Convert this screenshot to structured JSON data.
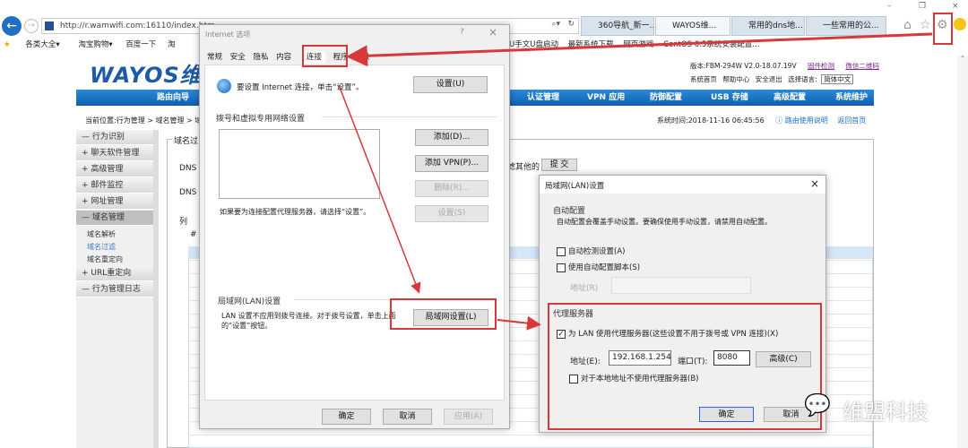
{
  "browser": {
    "url": "http://r.wamwifi.com:16110/index.htm",
    "tabs": [
      "360导航_新一...",
      "WAYOS维...",
      "常用的dns地...",
      "一些常用的公..."
    ],
    "bookmarks": [
      "各类大全▾",
      "淘宝购物▾",
      "百度一下",
      "淘",
      "U手文U盘启动",
      "最新系统下载",
      "网页游戏",
      "CentOS 6.5系统安装配置..."
    ]
  },
  "page": {
    "logo": "WAYOS维",
    "version": "版本:FBM-294W V2.0-18.07.19V",
    "version_links": [
      "固件检测",
      "微信二维码"
    ],
    "top_links": [
      "系统首页",
      "帮助中心",
      "安全退出",
      "选择语言:"
    ],
    "language": "简体中文",
    "nav": [
      "路由向导",
      "认证管理",
      "VPN 应用",
      "防御配置",
      "USB 存储",
      "高级配置",
      "系统维护"
    ],
    "breadcrumb": "当前位置:行为管理 > 域名管理 > 域",
    "system_time": "系统时间:2018-11-16 06:45:56",
    "help_link": "路由使用说明",
    "home_link": "返回首页",
    "sidebar": [
      "行为识别",
      "聊天软件管理",
      "高级管理",
      "邮件监控",
      "网址管理",
      "域名管理",
      "URL重定向",
      "行为管理日志"
    ],
    "sidebar_sub": [
      "域名解析",
      "域名过滤",
      "域名重定向"
    ],
    "content": {
      "legend": "域名过",
      "dns1": "DNS 过",
      "dns2": "DNS 1",
      "list": "列",
      "hash": "#",
      "filter_other": "滤其他的",
      "submit": "提 交"
    }
  },
  "inet_dialog": {
    "title": "Internet 选项",
    "help": "?",
    "close": "×",
    "tabs": [
      "常规",
      "安全",
      "隐私",
      "内容",
      "连接",
      "程序",
      "高级"
    ],
    "setup_text": "要设置 Internet 连接，单击“设置”。",
    "setup_btn": "设置(U)",
    "dialup_title": "拨号和虚拟专用网络设置",
    "add_btn": "添加(D)...",
    "add_vpn_btn": "添加 VPN(P)...",
    "remove_btn": "删除(R)...",
    "settings_btn": "设置(S)",
    "proxy_hint": "如果要为连接配置代理服务器，请选择“设置”。",
    "lan_title": "局域网(LAN)设置",
    "lan_text": "LAN 设置不应用到拨号连接。对于拨号设置，单击上面的“设置”按钮。",
    "lan_btn": "局域网设置(L)",
    "ok": "确定",
    "cancel": "取消",
    "apply": "应用(A)"
  },
  "lan_dialog": {
    "title": "局域网(LAN)设置",
    "close": "×",
    "auto_title": "自动配置",
    "auto_text": "自动配置会覆盖手动设置。要确保使用手动设置，请禁用自动配置。",
    "auto_detect": "自动检测设置(A)",
    "auto_detect_checked": false,
    "auto_script": "使用自动配置脚本(S)",
    "auto_script_checked": false,
    "script_addr_label": "地址(R)",
    "proxy_title": "代理服务器",
    "use_proxy": "为 LAN 使用代理服务器(这些设置不用于拨号或 VPN 连接)(X)",
    "use_proxy_checked": true,
    "addr_label": "地址(E):",
    "addr_value": "192.168.1.254",
    "port_label": "端口(T):",
    "port_value": "8080",
    "advanced_btn": "高级(C)",
    "bypass_local": "对于本地地址不使用代理服务器(B)",
    "bypass_local_checked": false,
    "ok": "确定",
    "cancel": "取消"
  },
  "watermark": "维盟科技"
}
